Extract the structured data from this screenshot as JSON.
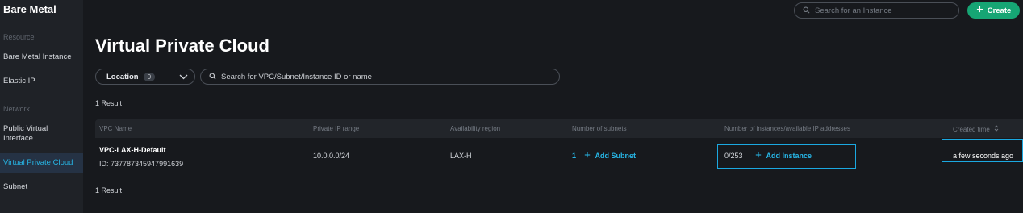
{
  "sidebar": {
    "title": "Bare Metal",
    "sections": [
      {
        "label": "Resource",
        "items": [
          "Bare Metal Instance",
          "Elastic IP"
        ]
      },
      {
        "label": "Network",
        "items": [
          "Public Virtual Interface",
          "Virtual Private Cloud",
          "Subnet"
        ]
      }
    ],
    "active_item": "Virtual Private Cloud"
  },
  "header": {
    "search_placeholder": "Search for an Instance",
    "create_label": "Create"
  },
  "page": {
    "title": "Virtual Private Cloud",
    "location_label": "Location",
    "location_count": "0",
    "search_placeholder": "Search for VPC/Subnet/Instance ID or name",
    "result_count_top": "1 Result",
    "result_count_bottom": "1 Result"
  },
  "table": {
    "columns": [
      "VPC Name",
      "Private IP range",
      "Availability region",
      "Number of subnets",
      "Number of instances/available IP addresses",
      "Created time"
    ],
    "rows": [
      {
        "vpc_name": "VPC-LAX-H-Default",
        "vpc_id": "ID: 737787345947991639",
        "ip_range": "10.0.0.0/24",
        "region": "LAX-H",
        "subnets": "1",
        "add_subnet": "Add Subnet",
        "instances": "0/253",
        "add_instance": "Add Instance",
        "created": "a few seconds ago"
      }
    ]
  },
  "colors": {
    "accent": "#27b6e6",
    "create_button": "#16a574",
    "background": "#17191d",
    "sidebar": "#1f2227",
    "highlight_box": "#1ba8e0"
  }
}
